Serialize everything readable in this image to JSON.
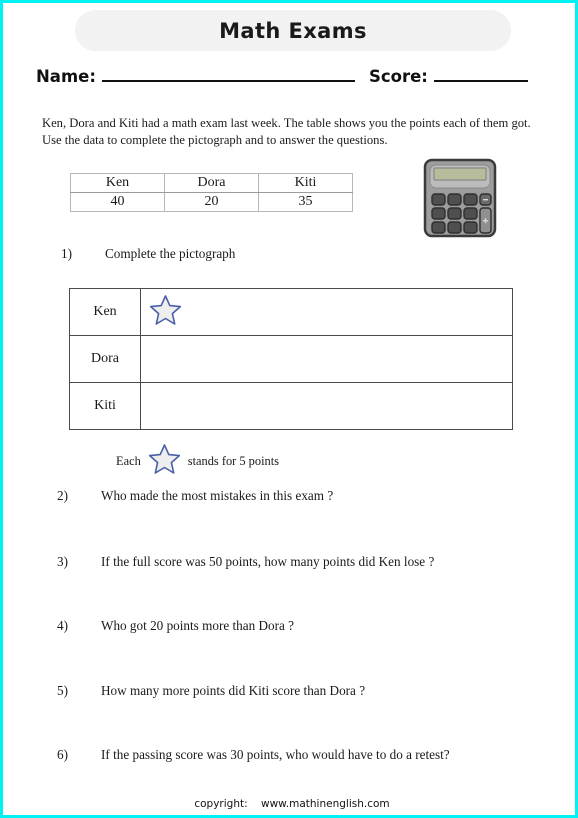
{
  "page": {
    "border_color": "#00f2f2",
    "background": "#ffffff"
  },
  "header": {
    "title": "Math Exams",
    "banner_color": "#f2f2f2",
    "name_label": "Name:",
    "score_label": "Score:"
  },
  "intro": "Ken, Dora and Kiti had a math exam last week. The table shows you the points each of them got. Use the data to complete the pictograph and to answer the questions.",
  "score_table": {
    "headers": [
      "Ken",
      "Dora",
      "Kiti"
    ],
    "values": [
      "40",
      "20",
      "35"
    ]
  },
  "calculator": {
    "icon": "calculator-icon",
    "body_color": "#9a9a9a",
    "display_color": "#b5bb9a",
    "key_color": "#4a4a4a"
  },
  "pictograph": {
    "rows": [
      {
        "name": "Ken",
        "stars": 1
      },
      {
        "name": "Dora",
        "stars": 0
      },
      {
        "name": "Kiti",
        "stars": 0
      }
    ],
    "star_outline_color": "#4a5fa8",
    "star_fill_color": "#eeeeee"
  },
  "legend": {
    "prefix": "Each",
    "suffix": "stands for 5 points"
  },
  "questions": [
    {
      "num": "1)",
      "text": "Complete the pictograph"
    },
    {
      "num": "2)",
      "text": "Who made the most mistakes in this exam ?"
    },
    {
      "num": "3)",
      "text": "If the full score was 50 points, how many points did Ken lose ?"
    },
    {
      "num": "4)",
      "text": "Who got 20 points more than Dora ?"
    },
    {
      "num": "5)",
      "text": "How many more points did Kiti score than Dora ?"
    },
    {
      "num": "6)",
      "text": "If the passing score was 30 points, who would have to do a retest?"
    }
  ],
  "footer": {
    "copyright_label": "copyright:",
    "url": "www.mathinenglish.com"
  },
  "chart_data": {
    "type": "table",
    "title": "Math Exams",
    "categories": [
      "Ken",
      "Dora",
      "Kiti"
    ],
    "values": [
      40,
      20,
      35
    ],
    "ylabel": "points",
    "pictograph_unit": 5,
    "pictograph_stars": [
      1,
      0,
      0
    ]
  }
}
